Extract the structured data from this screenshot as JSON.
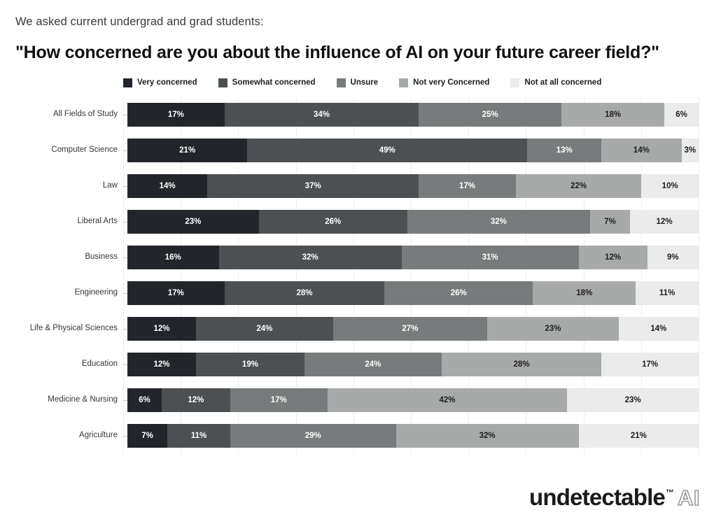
{
  "header": {
    "subtitle": "We asked current undergrad and grad students:",
    "title": "\"How concerned are you about the influence of AI on your future career field?\""
  },
  "legend": {
    "items": [
      {
        "label": "Very concerned",
        "color": "#22262a"
      },
      {
        "label": "Somewhat concerned",
        "color": "#4d5052"
      },
      {
        "label": "Unsure",
        "color": "#787b7b"
      },
      {
        "label": "Not very Concerned",
        "color": "#a8aaaa"
      },
      {
        "label": "Not at all concerned",
        "color": "#ebebeb"
      }
    ]
  },
  "footer": {
    "logo_word": "undetectable",
    "logo_tm": "™",
    "logo_ai": "AI"
  },
  "chart_data": {
    "type": "bar",
    "subtype": "stacked-horizontal-100",
    "title": "\"How concerned are you about the influence of AI on your future career field?\"",
    "subtitle": "We asked current undergrad and grad students:",
    "xlabel": "",
    "ylabel": "",
    "xlim": [
      0,
      100
    ],
    "grid": true,
    "legend_position": "top",
    "value_suffix": "%",
    "categories": [
      "All Fields of Study",
      "Computer Science",
      "Law",
      "Liberal Arts",
      "Business",
      "Engineering",
      "Life & Physical Sciences",
      "Education",
      "Medicine & Nursing",
      "Agriculture"
    ],
    "series": [
      {
        "name": "Very concerned",
        "color": "#22262a",
        "text_color": "#ffffff",
        "values": [
          17,
          21,
          14,
          23,
          16,
          17,
          12,
          12,
          6,
          7
        ]
      },
      {
        "name": "Somewhat concerned",
        "color": "#4d5052",
        "text_color": "#ffffff",
        "values": [
          34,
          49,
          37,
          26,
          32,
          28,
          24,
          19,
          12,
          11
        ]
      },
      {
        "name": "Unsure",
        "color": "#787b7b",
        "text_color": "#ffffff",
        "values": [
          25,
          13,
          17,
          32,
          31,
          26,
          27,
          24,
          17,
          29
        ]
      },
      {
        "name": "Not very Concerned",
        "color": "#a8aaaa",
        "text_color": "#1d1d1d",
        "values": [
          18,
          14,
          22,
          7,
          12,
          18,
          23,
          28,
          42,
          32
        ]
      },
      {
        "name": "Not at all concerned",
        "color": "#ebebeb",
        "text_color": "#1d1d1d",
        "values": [
          6,
          3,
          10,
          12,
          9,
          11,
          14,
          17,
          23,
          21
        ]
      }
    ],
    "labels": [
      [
        "17%",
        "34%",
        "25%",
        "18%",
        "6%"
      ],
      [
        "21%",
        "49%",
        "13%",
        "14%",
        "3%"
      ],
      [
        "14%",
        "37%",
        "17%",
        "22%",
        "10%"
      ],
      [
        "23%",
        "26%",
        "32%",
        "7%",
        "12%"
      ],
      [
        "16%",
        "32%",
        "31%",
        "12%",
        "9%"
      ],
      [
        "17%",
        "28%",
        "26%",
        "18%",
        "11%"
      ],
      [
        "12%",
        "24%",
        "27%",
        "23%",
        "14%"
      ],
      [
        "12%",
        "19%",
        "24%",
        "28%",
        "17%"
      ],
      [
        "6%",
        "12%",
        "17%",
        "42%",
        "23%"
      ],
      [
        "7%",
        "11%",
        "29%",
        "32%",
        "21%"
      ]
    ],
    "gridline_positions": [
      0,
      10,
      20,
      30,
      40,
      50,
      60,
      70,
      80,
      90,
      100
    ]
  }
}
